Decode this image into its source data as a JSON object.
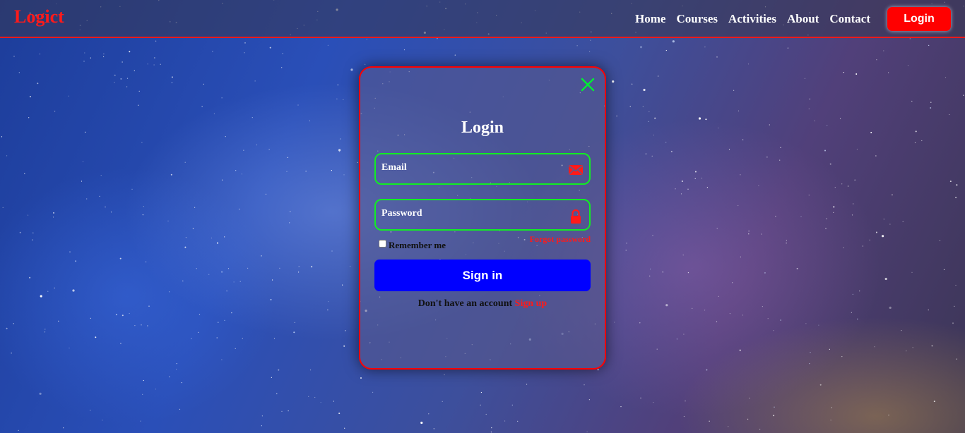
{
  "navbar": {
    "logo": "Logict",
    "links": [
      "Home",
      "Courses",
      "Activities",
      "About",
      "Contact"
    ],
    "login_button": "Login"
  },
  "modal": {
    "title": "Login",
    "email_label": "Email",
    "password_label": "Password",
    "remember_label": "Remember me",
    "remember_checked": false,
    "forgot_label": "Forgot password",
    "signin_label": "Sign in",
    "no_account_text": "Don't have an account",
    "signup_label": "Sign up"
  },
  "icons": {
    "close": "close-icon",
    "email": "envelope-icon",
    "password": "lock-icon"
  },
  "colors": {
    "accent_red": "#ff0000",
    "field_border_green": "#11ee22",
    "signin_blue": "#0000ff",
    "close_icon_green": "#00ee33"
  }
}
